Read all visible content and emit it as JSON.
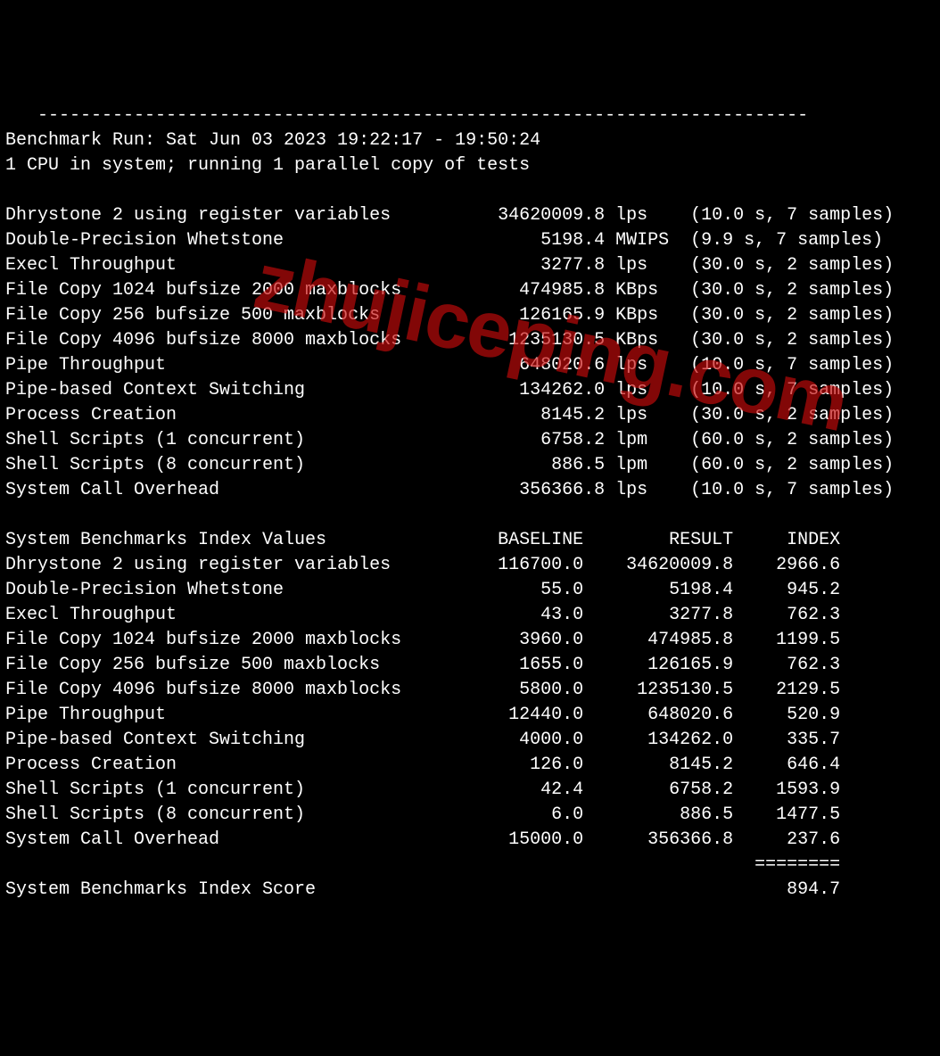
{
  "separator": "------------------------------------------------------------------------",
  "header": {
    "run_line": "Benchmark Run: Sat Jun 03 2023 19:22:17 - 19:50:24",
    "cpu_line": "1 CPU in system; running 1 parallel copy of tests"
  },
  "results": [
    {
      "name": "Dhrystone 2 using register variables",
      "value": "34620009.8",
      "unit": "lps",
      "timing": "(10.0 s, 7 samples)"
    },
    {
      "name": "Double-Precision Whetstone",
      "value": "5198.4",
      "unit": "MWIPS",
      "timing": "(9.9 s, 7 samples)"
    },
    {
      "name": "Execl Throughput",
      "value": "3277.8",
      "unit": "lps",
      "timing": "(30.0 s, 2 samples)"
    },
    {
      "name": "File Copy 1024 bufsize 2000 maxblocks",
      "value": "474985.8",
      "unit": "KBps",
      "timing": "(30.0 s, 2 samples)"
    },
    {
      "name": "File Copy 256 bufsize 500 maxblocks",
      "value": "126165.9",
      "unit": "KBps",
      "timing": "(30.0 s, 2 samples)"
    },
    {
      "name": "File Copy 4096 bufsize 8000 maxblocks",
      "value": "1235130.5",
      "unit": "KBps",
      "timing": "(30.0 s, 2 samples)"
    },
    {
      "name": "Pipe Throughput",
      "value": "648020.6",
      "unit": "lps",
      "timing": "(10.0 s, 7 samples)"
    },
    {
      "name": "Pipe-based Context Switching",
      "value": "134262.0",
      "unit": "lps",
      "timing": "(10.0 s, 7 samples)"
    },
    {
      "name": "Process Creation",
      "value": "8145.2",
      "unit": "lps",
      "timing": "(30.0 s, 2 samples)"
    },
    {
      "name": "Shell Scripts (1 concurrent)",
      "value": "6758.2",
      "unit": "lpm",
      "timing": "(60.0 s, 2 samples)"
    },
    {
      "name": "Shell Scripts (8 concurrent)",
      "value": "886.5",
      "unit": "lpm",
      "timing": "(60.0 s, 2 samples)"
    },
    {
      "name": "System Call Overhead",
      "value": "356366.8",
      "unit": "lps",
      "timing": "(10.0 s, 7 samples)"
    }
  ],
  "index_header": {
    "title": "System Benchmarks Index Values",
    "col_baseline": "BASELINE",
    "col_result": "RESULT",
    "col_index": "INDEX"
  },
  "index": [
    {
      "name": "Dhrystone 2 using register variables",
      "baseline": "116700.0",
      "result": "34620009.8",
      "index": "2966.6"
    },
    {
      "name": "Double-Precision Whetstone",
      "baseline": "55.0",
      "result": "5198.4",
      "index": "945.2"
    },
    {
      "name": "Execl Throughput",
      "baseline": "43.0",
      "result": "3277.8",
      "index": "762.3"
    },
    {
      "name": "File Copy 1024 bufsize 2000 maxblocks",
      "baseline": "3960.0",
      "result": "474985.8",
      "index": "1199.5"
    },
    {
      "name": "File Copy 256 bufsize 500 maxblocks",
      "baseline": "1655.0",
      "result": "126165.9",
      "index": "762.3"
    },
    {
      "name": "File Copy 4096 bufsize 8000 maxblocks",
      "baseline": "5800.0",
      "result": "1235130.5",
      "index": "2129.5"
    },
    {
      "name": "Pipe Throughput",
      "baseline": "12440.0",
      "result": "648020.6",
      "index": "520.9"
    },
    {
      "name": "Pipe-based Context Switching",
      "baseline": "4000.0",
      "result": "134262.0",
      "index": "335.7"
    },
    {
      "name": "Process Creation",
      "baseline": "126.0",
      "result": "8145.2",
      "index": "646.4"
    },
    {
      "name": "Shell Scripts (1 concurrent)",
      "baseline": "42.4",
      "result": "6758.2",
      "index": "1593.9"
    },
    {
      "name": "Shell Scripts (8 concurrent)",
      "baseline": "6.0",
      "result": "886.5",
      "index": "1477.5"
    },
    {
      "name": "System Call Overhead",
      "baseline": "15000.0",
      "result": "356366.8",
      "index": "237.6"
    }
  ],
  "score_sep": "========",
  "score": {
    "label": "System Benchmarks Index Score",
    "value": "894.7"
  },
  "watermark": "zhujiceping.com"
}
